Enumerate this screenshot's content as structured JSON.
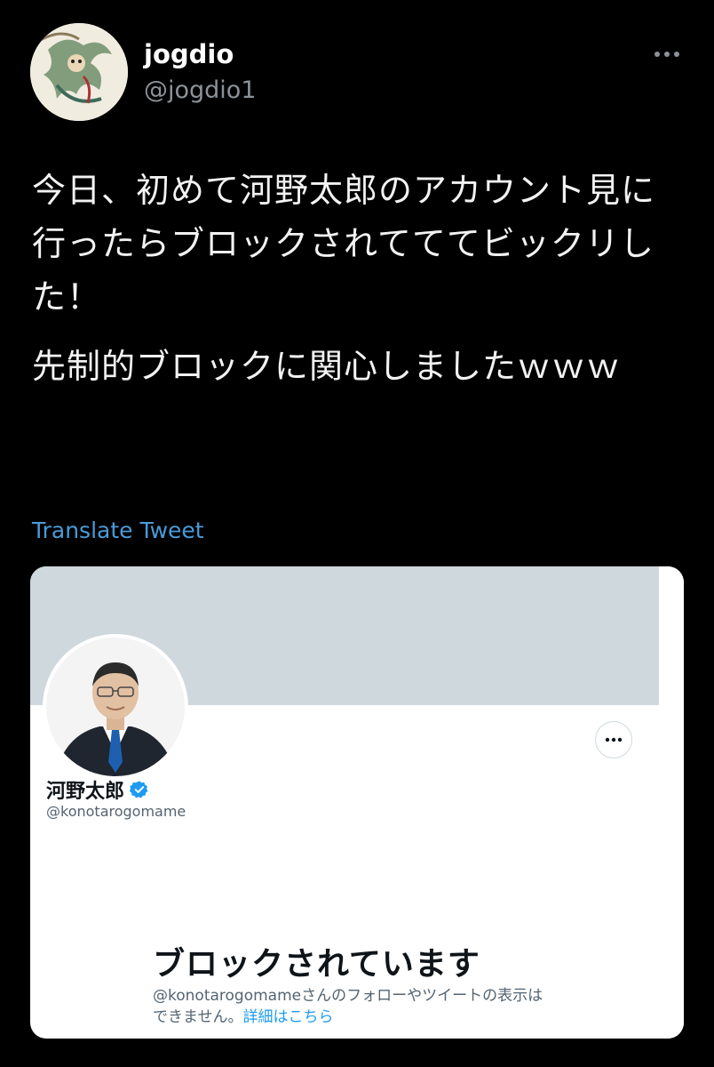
{
  "author": {
    "display_name": "jogdio",
    "handle": "@jogdio1",
    "avatar_icon": "fujin-painting-avatar"
  },
  "tweet": {
    "paragraphs": [
      "今日、初めて河野太郎のアカウント見に行ったらブロックされてててビックリした！",
      "先制的ブロックに関心しましたｗｗｗ"
    ],
    "translate_label": "Translate Tweet"
  },
  "card": {
    "profile_name": "河野太郎",
    "profile_handle": "@konotarogomame",
    "verified_icon": "verified-badge-icon",
    "blocked_title": "ブロックされています",
    "blocked_desc": "@konotarogomameさんのフォローやツイートの表示はできません。",
    "blocked_link": "詳細はこちら"
  },
  "colors": {
    "background": "#000000",
    "link_blue": "#4a9bd9",
    "verified_blue": "#1d9bf0",
    "banner_gray": "#cfd8dc"
  }
}
